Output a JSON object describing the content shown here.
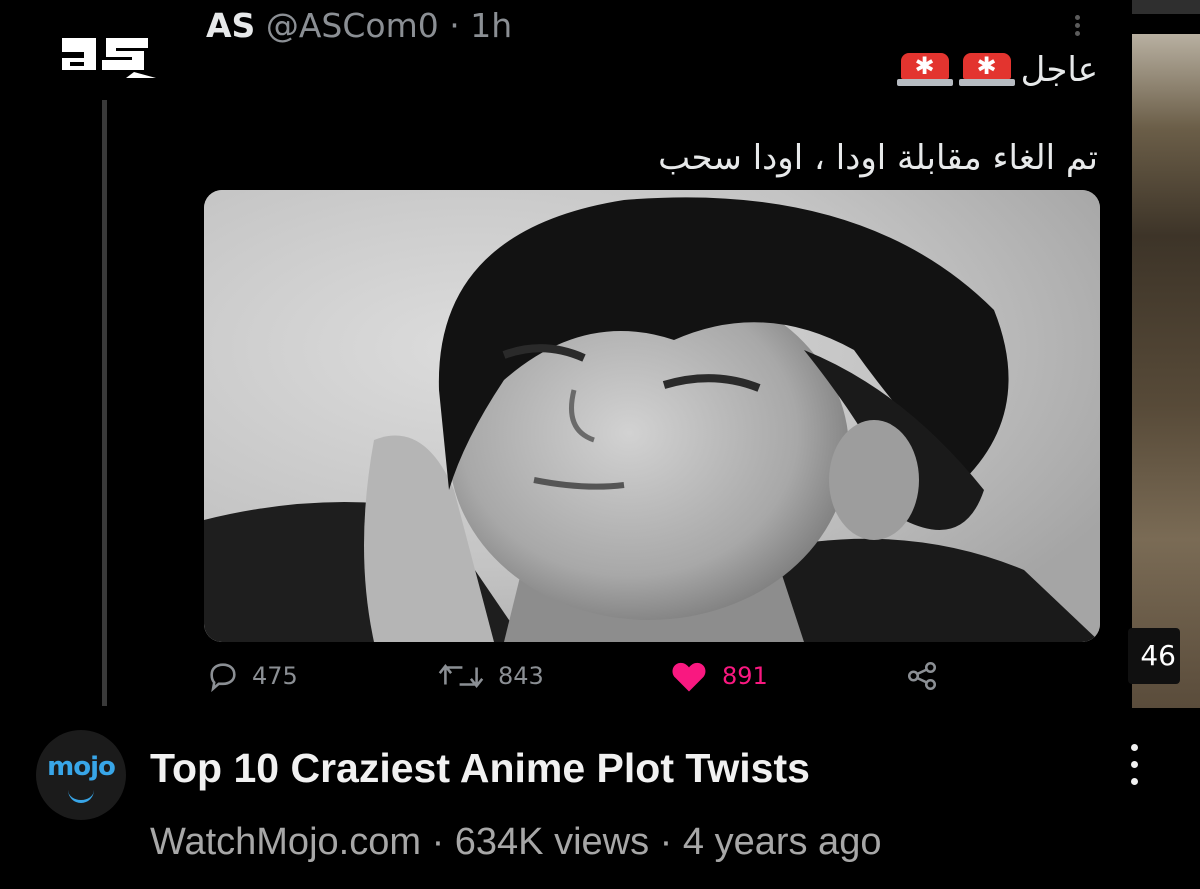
{
  "tweet": {
    "display_name": "AS",
    "handle": "@ASCom0",
    "separator": "·",
    "time": "1h",
    "line1_text": "عاجل",
    "line2_text": "تم الغاء مقابلة اودا ، اودا سحب",
    "siren_emoji": "🚨",
    "stats": {
      "replies": "475",
      "retweets": "843",
      "likes": "891"
    },
    "colors": {
      "like": "#f91880",
      "muted": "#8b8f94"
    }
  },
  "logo": {
    "icon": "as-logo-icon"
  },
  "right_strip": {
    "duration_fragment": "46"
  },
  "video": {
    "channel_avatar_text": "mojo",
    "title": "Top 10 Craziest Anime Plot Twists",
    "channel": "WatchMojo.com",
    "views": "634K views",
    "age": "4 years ago",
    "meta_separator": "·"
  }
}
